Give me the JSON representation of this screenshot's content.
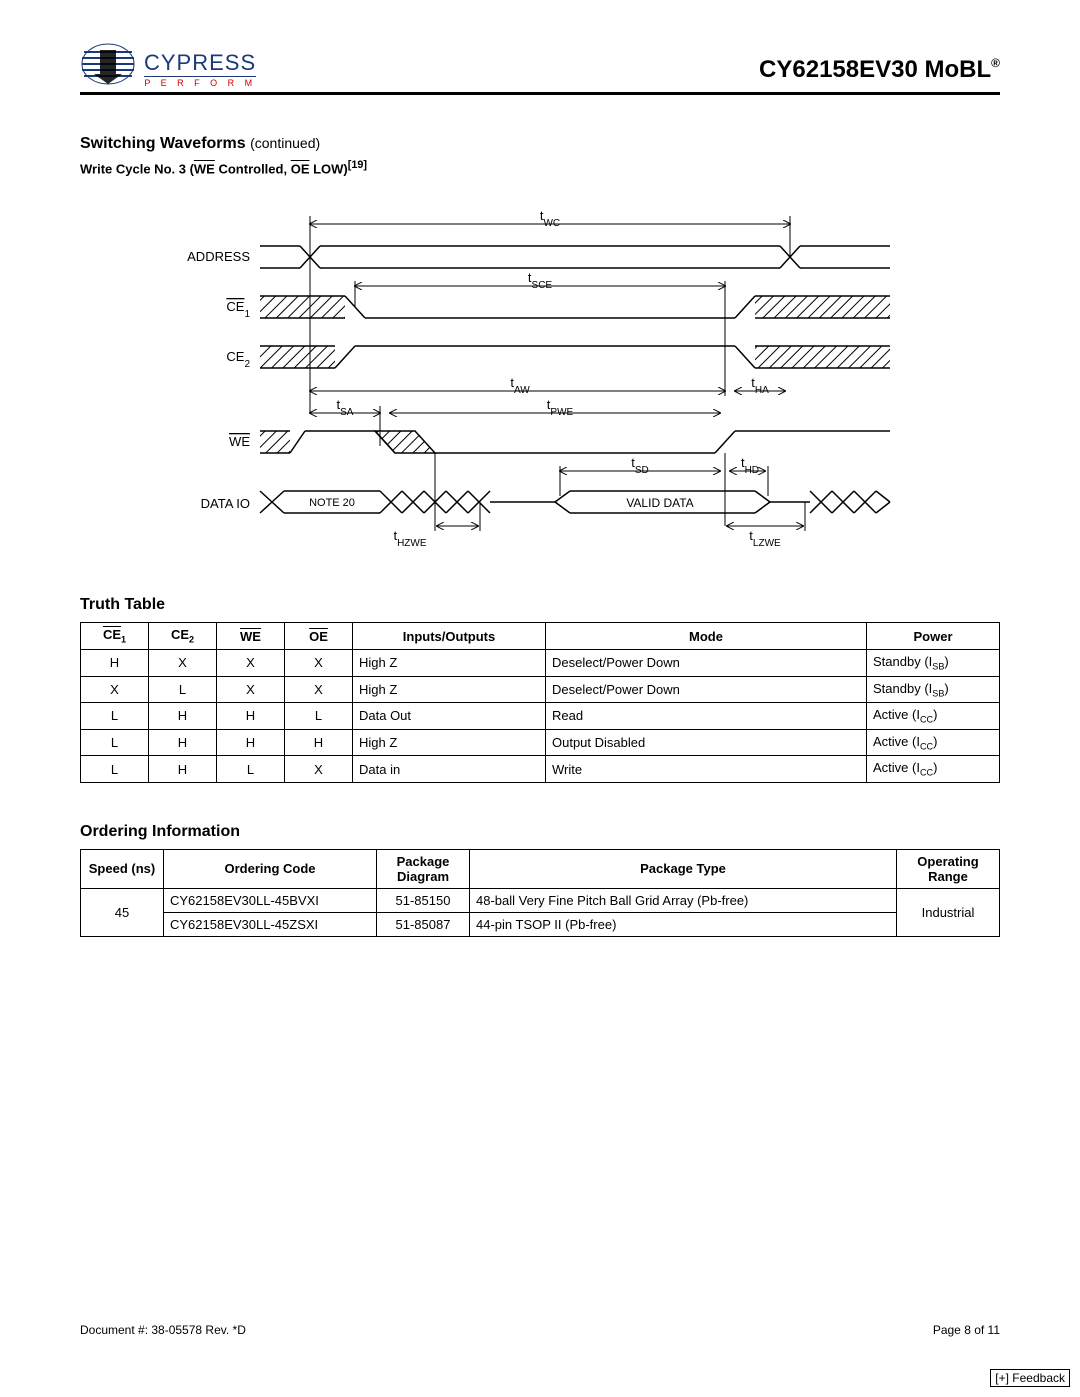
{
  "header": {
    "logo_main": "CYPRESS",
    "logo_sub": "P E R F O R M",
    "part_number": "CY62158EV30 MoBL",
    "reg": "®"
  },
  "section": {
    "title": "Switching Waveforms",
    "continued": "(continued)",
    "subtitle_prefix": "Write Cycle No. 3 (",
    "subtitle_we": "WE",
    "subtitle_mid": " Controlled, ",
    "subtitle_oe": "OE",
    "subtitle_suffix": " LOW)",
    "note_ref": "[19]"
  },
  "waveform": {
    "signals": [
      "ADDRESS",
      "CE1",
      "CE2",
      "WE",
      "DATA IO"
    ],
    "ce1_label_main": "CE",
    "ce1_sub": "1",
    "ce2_label_main": "CE",
    "ce2_sub": "2",
    "we_label": "WE",
    "timings": {
      "tWC": "WC",
      "tSCE": "SCE",
      "tAW": "AW",
      "tHA": "HA",
      "tSA": "SA",
      "tPWE": "PWE",
      "tSD": "SD",
      "tHD": "HD",
      "tHZWE": "HZWE",
      "tLZWE": "LZWE"
    },
    "note20": "NOTE 20",
    "valid_data": "VALID DATA"
  },
  "truth_table": {
    "title": "Truth Table",
    "headers": {
      "ce1": "CE",
      "ce1_sub": "1",
      "ce2": "CE",
      "ce2_sub": "2",
      "we": "WE",
      "oe": "OE",
      "io": "Inputs/Outputs",
      "mode": "Mode",
      "power": "Power"
    },
    "rows": [
      {
        "ce1": "H",
        "ce2": "X",
        "we": "X",
        "oe": "X",
        "io": "High Z",
        "mode": "Deselect/Power Down",
        "power_pre": "Standby (I",
        "power_sub": "SB",
        "power_post": ")"
      },
      {
        "ce1": "X",
        "ce2": "L",
        "we": "X",
        "oe": "X",
        "io": "High Z",
        "mode": "Deselect/Power Down",
        "power_pre": "Standby (I",
        "power_sub": "SB",
        "power_post": ")"
      },
      {
        "ce1": "L",
        "ce2": "H",
        "we": "H",
        "oe": "L",
        "io": "Data Out",
        "mode": "Read",
        "power_pre": "Active (I",
        "power_sub": "CC",
        "power_post": ")"
      },
      {
        "ce1": "L",
        "ce2": "H",
        "we": "H",
        "oe": "H",
        "io": "High Z",
        "mode": "Output Disabled",
        "power_pre": "Active (I",
        "power_sub": "CC",
        "power_post": ")"
      },
      {
        "ce1": "L",
        "ce2": "H",
        "we": "L",
        "oe": "X",
        "io": "Data in",
        "mode": "Write",
        "power_pre": "Active (I",
        "power_sub": "CC",
        "power_post": ")"
      }
    ]
  },
  "ordering": {
    "title": "Ordering Information",
    "headers": {
      "speed": "Speed (ns)",
      "code": "Ordering Code",
      "pkg_diag": "Package Diagram",
      "pkg_type": "Package Type",
      "op_range": "Operating Range"
    },
    "speed": "45",
    "op_range": "Industrial",
    "rows": [
      {
        "code": "CY62158EV30LL-45BVXI",
        "diag": "51-85150",
        "type": "48-ball Very Fine Pitch Ball Grid Array (Pb-free)"
      },
      {
        "code": "CY62158EV30LL-45ZSXI",
        "diag": "51-85087",
        "type": "44-pin TSOP II (Pb-free)"
      }
    ]
  },
  "footer": {
    "doc": "Document #: 38-05578 Rev. *D",
    "page": "Page 8 of 11",
    "feedback": "[+] Feedback"
  }
}
